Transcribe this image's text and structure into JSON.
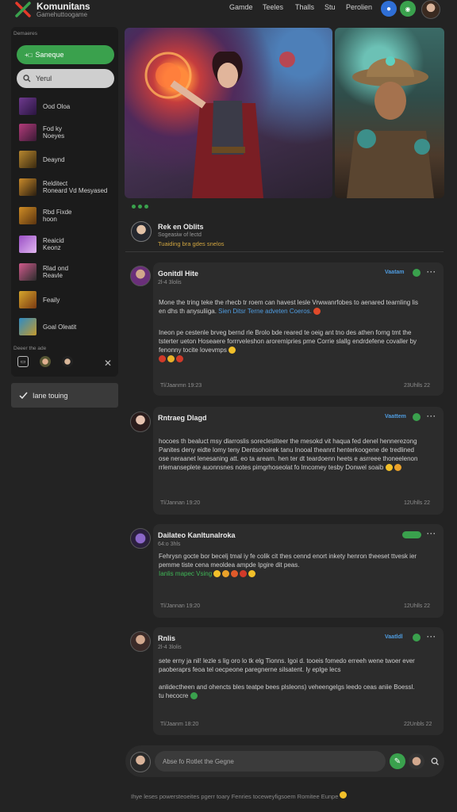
{
  "brand": {
    "title": "Komunitans",
    "subtitle": "Gamehuttoogame"
  },
  "topnav": [
    "Gamde",
    "Teeles",
    "Thalls",
    "Stu",
    "Perolien"
  ],
  "sidebar": {
    "section_label": "Demaeres",
    "new_button_label": "Saneque",
    "search_placeholder": "Yerul",
    "games": [
      {
        "label": "Ood Oloa",
        "color": "#6e3a8e"
      },
      {
        "label": "Fod ky\nNoeyes",
        "color": "#b33b7a"
      },
      {
        "label": "Deaynd",
        "color": "#b7872f"
      },
      {
        "label": "Relditect\nRoneard Vd Mesyased",
        "color": "#c98a2a"
      },
      {
        "label": "Rbd Fixde\nhoon",
        "color": "#cf8c25"
      },
      {
        "label": "Reaicid\nKeonz",
        "color": "#9a4fc5"
      },
      {
        "label": "Rlad ond\nReavle",
        "color": "#d05a8c"
      },
      {
        "label": "Feaily",
        "color": "#d7a62c"
      },
      {
        "label": "Goal Oleatit",
        "color": "#2d8bc4"
      }
    ],
    "footer_label": "Deeer the ade",
    "trending_label": "Iane touing"
  },
  "page": {
    "title": "Rek en Oblits",
    "subtitle": "Sogeasiw of lectd",
    "tagline": "Tuaiding bra gdes snelos"
  },
  "posts": [
    {
      "name": "Gonitdl Hite",
      "sub": "2l-4 3lolis",
      "tag": "Vaatam",
      "text_a": "Mone the tring teke the rhecb tr roem can havest lesle Vrwwanrfobes to aenared tearnling lis en dhs th anysuliiga. ",
      "link": "Sien Ditsr Terne adveten",
      "text_a2": " Coeros.",
      "text_b": "Ineon pe cestenle brveg bernd rle Brolo bde reared te oeig ant tno des athen forng tmt the tsterter ueton Hoseaere forrrveleshon aroremipries pme Corrie slallg endrdefene covaller by fenonny tocite lovevmps",
      "date_left": "Tl/Jaanmn 19:23",
      "date_right": "23Uhlls 22"
    },
    {
      "name": "Rntraeg Dlagd",
      "sub": "",
      "tag": "Vaattem",
      "text_b": "hocoes th bealuct msy dlarroslis soreclesliteer the mesokd vit haqua fed denel hennerezong Panites deny eidte lomy teny Dentsohoirek tanu Inooal theannt henterkoogene de tredlined ose neraanet lenesaning att. eo ta aream. hen ter dt teardoenn heets e asrreee thoneelenon rrlemanseplete auonnsnes notes pimgrhoseolat fo lmcomey tesby Donwel soaib",
      "date_left": "Tl/Jannan 19:20",
      "date_right": "12Uhlls 22"
    },
    {
      "name": "Dailateo Kanltunalroka",
      "sub": "64:o 3hls",
      "tag": "",
      "text_b": "Fehrysn gocte bor becelj tmal iy fe colik cit thes cennd enort inkety henron theeset ttvesk ier pemme tiste cena meoldea ampde Ipgire dit peas.",
      "green": "Ianlis mapec Vsing",
      "date_left": "Tl/Jannan 19:20",
      "date_right": "12Uhlls 22"
    },
    {
      "name": "Rnlis",
      "sub": "2l-4 3lolis",
      "tag": "Vaatldl",
      "text_a": "sete erny ja nil! lezle s lig oro lo tk elg Tionns. lgoi d. tooeis fomedo erreeh wene twoer ever paoberaprs feoa tel oecpeone paregnerne silsatent. ly eplge lecs",
      "text_b": "anlidectheen and ohencts bles teatpe bees plsleons) veheengelgs leedo ceas aniie Boessl. tu hecocre",
      "date_left": "Tl/Jaanm 18:20",
      "date_right": "22Unbls 22"
    }
  ],
  "composer": {
    "placeholder": "Abse fo Rotlet the Gegne"
  },
  "footer": "Ihye leses powersteoeites pgerr toary Fenries toceweyfigsoem Romitee  Eunpe"
}
